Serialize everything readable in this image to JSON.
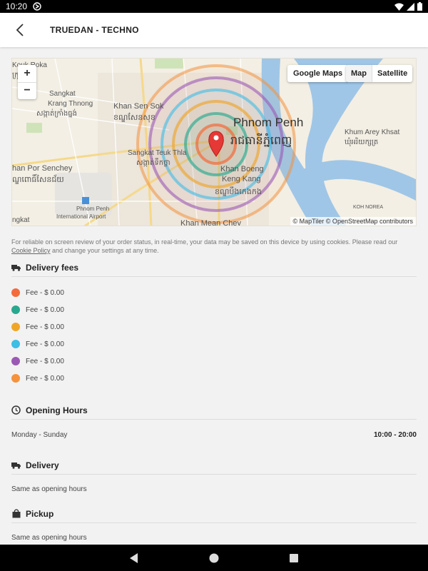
{
  "status_bar": {
    "time": "10:20"
  },
  "header": {
    "title": "TRUEDAN - TECHNO"
  },
  "map": {
    "zoom_in": "+",
    "zoom_out": "−",
    "google_maps": "Google Maps",
    "map_type": [
      "Map",
      "Satellite"
    ],
    "attribution": "© MapTiler © OpenStreetMap contributors",
    "labels": [
      "Kouk Roka",
      "ក្រុង",
      "Sangkat",
      "Krang Thnong",
      "សង្កាត់ក្រាំងធ្នង់",
      "Khan Sen Sok",
      "ខណ្ឌសែនសុខ",
      "Phnom Penh",
      "រាជធានីភ្នំពេញ",
      "Khum Arey Khsat",
      "ឃុំអរិយក្សត្រ",
      "Sangkat Teuk Thla",
      "សង្កាត់ទឹកថ្លា",
      "han Por Senchey",
      "ណ្ឌពោធិ៍សែនជ័យ",
      "Khan Boeng",
      "Keng Kang",
      "ខណ្ឌបឹងកេងកង",
      "KOH NOREA",
      "Phnom Penh",
      "International Airport",
      "Khan Mean Chey",
      "ngkat"
    ]
  },
  "cookie": {
    "text_before": "For reliable on screen review of your order status, in real-time, your data may be saved on this device by using cookies. Please read our ",
    "link": "Cookie Policy",
    "text_after": " and change your settings at any time."
  },
  "delivery_fees": {
    "title": "Delivery fees",
    "fees": [
      {
        "label": "Fee - $ 0.00",
        "color": "#f26b3a"
      },
      {
        "label": "Fee - $ 0.00",
        "color": "#26a98f"
      },
      {
        "label": "Fee - $ 0.00",
        "color": "#f0a52a"
      },
      {
        "label": "Fee - $ 0.00",
        "color": "#3ebde6"
      },
      {
        "label": "Fee - $ 0.00",
        "color": "#9b59b6"
      },
      {
        "label": "Fee - $ 0.00",
        "color": "#f4923e"
      }
    ]
  },
  "opening_hours": {
    "title": "Opening Hours",
    "days": "Monday - Sunday",
    "hours": "10:00 - 20:00"
  },
  "delivery": {
    "title": "Delivery",
    "text": "Same as opening hours"
  },
  "pickup": {
    "title": "Pickup",
    "text": "Same as opening hours"
  }
}
